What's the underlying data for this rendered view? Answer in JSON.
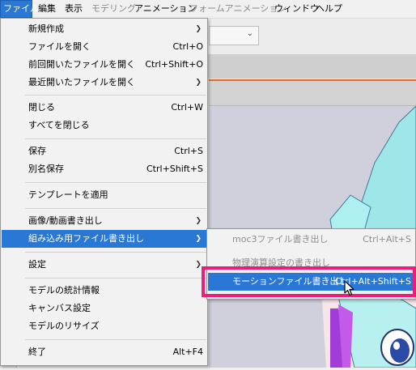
{
  "menubar": {
    "items": [
      {
        "label": "ファイル",
        "state": "active"
      },
      {
        "label": "編集",
        "state": "normal"
      },
      {
        "label": "表示",
        "state": "normal"
      },
      {
        "label": "モデリング",
        "state": "disabled"
      },
      {
        "label": "アニメーション",
        "state": "normal"
      },
      {
        "label": "フォームアニメーション",
        "state": "disabled"
      },
      {
        "label": "ウィンドウ",
        "state": "normal"
      },
      {
        "label": "ヘルプ",
        "state": "normal"
      }
    ]
  },
  "file_menu": {
    "items": [
      {
        "label": "新規作成",
        "shortcut": "",
        "submenu": true
      },
      {
        "label": "ファイルを開く",
        "shortcut": "Ctrl+O",
        "submenu": false
      },
      {
        "label": "前回開いたファイルを開く",
        "shortcut": "Ctrl+Shift+O",
        "submenu": false
      },
      {
        "label": "最近開いたファイルを開く",
        "shortcut": "",
        "submenu": true
      },
      {
        "label": "閉じる",
        "shortcut": "Ctrl+W",
        "submenu": false
      },
      {
        "label": "すべてを閉じる",
        "shortcut": "",
        "submenu": false
      },
      {
        "label": "保存",
        "shortcut": "Ctrl+S",
        "submenu": false
      },
      {
        "label": "別名保存",
        "shortcut": "Ctrl+Shift+S",
        "submenu": false
      },
      {
        "label": "テンプレートを適用",
        "shortcut": "",
        "submenu": false
      },
      {
        "label": "画像/動画書き出し",
        "shortcut": "",
        "submenu": true
      },
      {
        "label": "組み込み用ファイル書き出し",
        "shortcut": "",
        "submenu": true,
        "highlighted": true
      },
      {
        "label": "設定",
        "shortcut": "",
        "submenu": true
      },
      {
        "label": "モデルの統計情報",
        "shortcut": "",
        "submenu": false
      },
      {
        "label": "キャンバス設定",
        "shortcut": "",
        "submenu": false
      },
      {
        "label": "モデルのリサイズ",
        "shortcut": "",
        "submenu": false
      },
      {
        "label": "終了",
        "shortcut": "Alt+F4",
        "submenu": false
      }
    ]
  },
  "export_submenu": {
    "items": [
      {
        "label": "moc3ファイル書き出し",
        "shortcut": "Ctrl+Alt+S",
        "enabled": false
      },
      {
        "label": "物理演算設定の書き出し",
        "shortcut": "",
        "enabled": false
      },
      {
        "label": "モーションファイル書き出し",
        "shortcut": "Ctrl+Alt+Shift+S",
        "enabled": true,
        "highlighted": true
      }
    ]
  },
  "icons": {
    "submenu_arrow": "chevron-right-icon",
    "dropdown": "chevron-down-icon",
    "cursor": "mouse-pointer-icon"
  },
  "colors": {
    "highlight": "#2a78d6",
    "annotation": "#ec1e7a",
    "timeline_accent": "#e8692a"
  }
}
